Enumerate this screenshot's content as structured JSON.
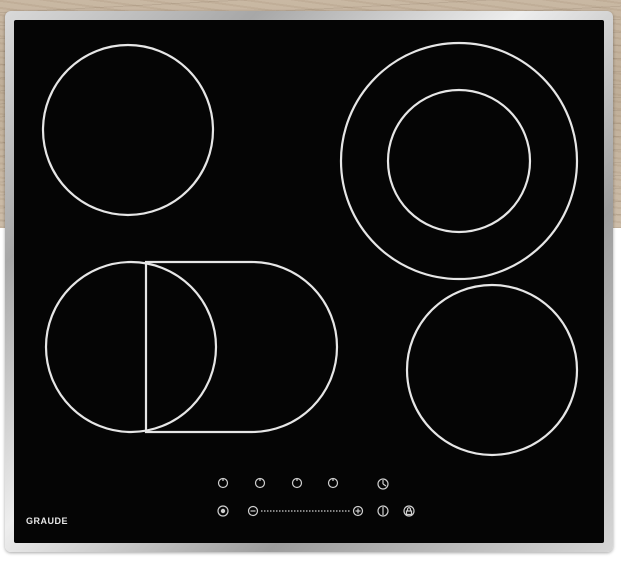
{
  "brand": {
    "name": "GRAUDE"
  },
  "colors": {
    "glass": "#050505",
    "zone_line": "#e6e6e6",
    "frame": "#bdbdbd",
    "countertop": "#c7b6a0"
  },
  "controls": {
    "top_row": [
      "zone-timer-icon",
      "zone-timer-icon",
      "zone-timer-icon",
      "zone-timer-icon",
      "timer-icon"
    ],
    "bottom_row": [
      "power-icon",
      "minus-icon",
      "slider",
      "plus-icon",
      "dual-zone-icon",
      "lock-icon"
    ]
  }
}
